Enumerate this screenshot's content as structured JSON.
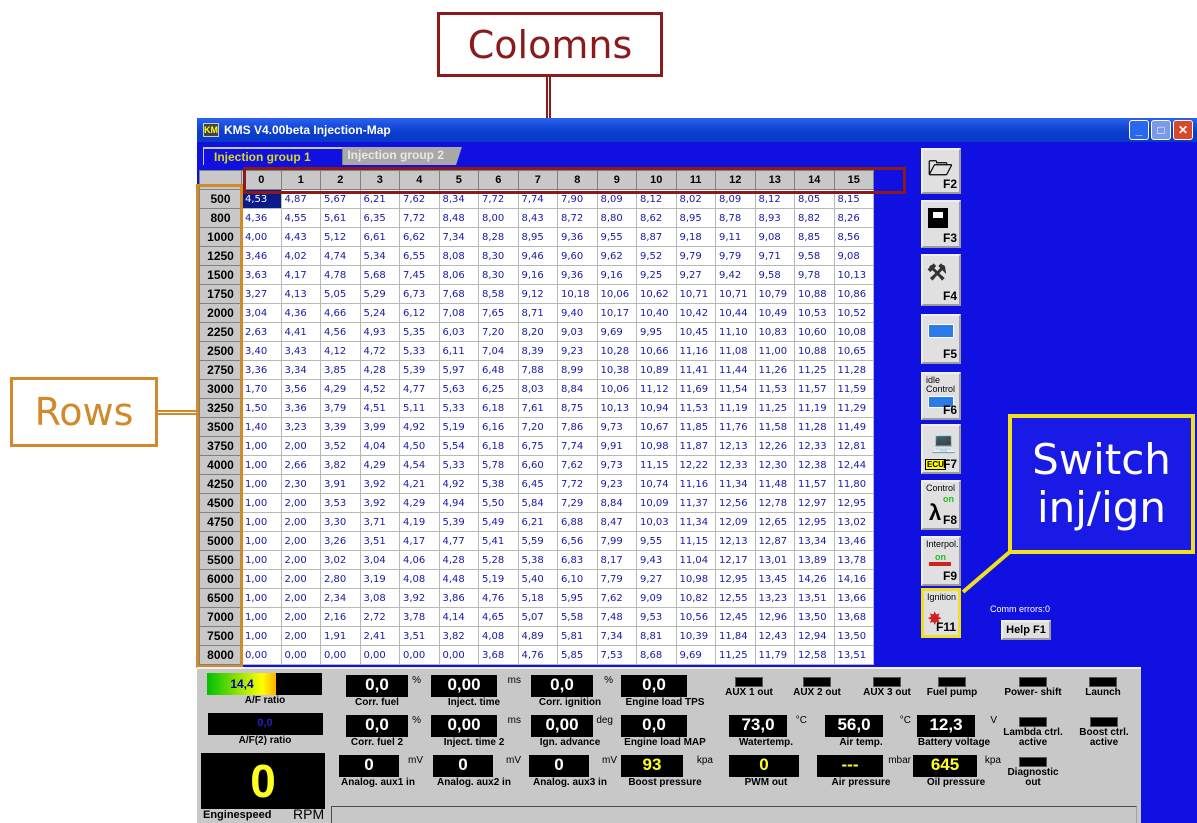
{
  "annotations": {
    "columns_label": "Colomns",
    "rows_label": "Rows",
    "switch_line1": "Switch",
    "switch_line2": "inj/ign"
  },
  "window": {
    "title": "KMS V4.00beta Injection-Map",
    "icon_text": "KM"
  },
  "tabs": [
    {
      "label": "Injection group 1",
      "active": true
    },
    {
      "label": "Injection group 2",
      "active": false
    }
  ],
  "grid": {
    "columns": [
      "0",
      "1",
      "2",
      "3",
      "4",
      "5",
      "6",
      "7",
      "8",
      "9",
      "10",
      "11",
      "12",
      "13",
      "14",
      "15"
    ],
    "rows": [
      {
        "rpm": "500",
        "values": [
          "4,53",
          "4,87",
          "5,67",
          "6,21",
          "7,62",
          "8,34",
          "7,72",
          "7,74",
          "7,90",
          "8,09",
          "8,12",
          "8,02",
          "8,09",
          "8,12",
          "8,05",
          "8,15"
        ]
      },
      {
        "rpm": "800",
        "values": [
          "4,36",
          "4,55",
          "5,61",
          "6,35",
          "7,72",
          "8,48",
          "8,00",
          "8,43",
          "8,72",
          "8,80",
          "8,62",
          "8,95",
          "8,78",
          "8,93",
          "8,82",
          "8,26"
        ]
      },
      {
        "rpm": "1000",
        "values": [
          "4,00",
          "4,43",
          "5,12",
          "6,61",
          "6,62",
          "7,34",
          "8,28",
          "8,95",
          "9,36",
          "9,55",
          "8,87",
          "9,18",
          "9,11",
          "9,08",
          "8,85",
          "8,56"
        ]
      },
      {
        "rpm": "1250",
        "values": [
          "3,46",
          "4,02",
          "4,74",
          "5,34",
          "6,55",
          "8,08",
          "8,30",
          "9,46",
          "9,60",
          "9,62",
          "9,52",
          "9,79",
          "9,79",
          "9,71",
          "9,58",
          "9,08"
        ]
      },
      {
        "rpm": "1500",
        "values": [
          "3,63",
          "4,17",
          "4,78",
          "5,68",
          "7,45",
          "8,06",
          "8,30",
          "9,16",
          "9,36",
          "9,16",
          "9,25",
          "9,27",
          "9,42",
          "9,58",
          "9,78",
          "10,13"
        ]
      },
      {
        "rpm": "1750",
        "values": [
          "3,27",
          "4,13",
          "5,05",
          "5,29",
          "6,73",
          "7,68",
          "8,58",
          "9,12",
          "10,18",
          "10,06",
          "10,62",
          "10,71",
          "10,71",
          "10,79",
          "10,88",
          "10,86"
        ]
      },
      {
        "rpm": "2000",
        "values": [
          "3,04",
          "4,36",
          "4,66",
          "5,24",
          "6,12",
          "7,08",
          "7,65",
          "8,71",
          "9,40",
          "10,17",
          "10,40",
          "10,42",
          "10,44",
          "10,49",
          "10,53",
          "10,52"
        ]
      },
      {
        "rpm": "2250",
        "values": [
          "2,63",
          "4,41",
          "4,56",
          "4,93",
          "5,35",
          "6,03",
          "7,20",
          "8,20",
          "9,03",
          "9,69",
          "9,95",
          "10,45",
          "11,10",
          "10,83",
          "10,60",
          "10,08"
        ]
      },
      {
        "rpm": "2500",
        "values": [
          "3,40",
          "3,43",
          "4,12",
          "4,72",
          "5,33",
          "6,11",
          "7,04",
          "8,39",
          "9,23",
          "10,28",
          "10,66",
          "11,16",
          "11,08",
          "11,00",
          "10,88",
          "10,65"
        ]
      },
      {
        "rpm": "2750",
        "values": [
          "3,36",
          "3,34",
          "3,85",
          "4,28",
          "5,39",
          "5,97",
          "6,48",
          "7,88",
          "8,99",
          "10,38",
          "10,89",
          "11,41",
          "11,44",
          "11,26",
          "11,25",
          "11,28"
        ]
      },
      {
        "rpm": "3000",
        "values": [
          "1,70",
          "3,56",
          "4,29",
          "4,52",
          "4,77",
          "5,63",
          "6,25",
          "8,03",
          "8,84",
          "10,06",
          "11,12",
          "11,69",
          "11,54",
          "11,53",
          "11,57",
          "11,59"
        ]
      },
      {
        "rpm": "3250",
        "values": [
          "1,50",
          "3,36",
          "3,79",
          "4,51",
          "5,11",
          "5,33",
          "6,18",
          "7,61",
          "8,75",
          "10,13",
          "10,94",
          "11,53",
          "11,19",
          "11,25",
          "11,19",
          "11,29"
        ]
      },
      {
        "rpm": "3500",
        "values": [
          "1,40",
          "3,23",
          "3,39",
          "3,99",
          "4,92",
          "5,19",
          "6,16",
          "7,20",
          "7,86",
          "9,73",
          "10,67",
          "11,85",
          "11,76",
          "11,58",
          "11,28",
          "11,49"
        ]
      },
      {
        "rpm": "3750",
        "values": [
          "1,00",
          "2,00",
          "3,52",
          "4,04",
          "4,50",
          "5,54",
          "6,18",
          "6,75",
          "7,74",
          "9,91",
          "10,98",
          "11,87",
          "12,13",
          "12,26",
          "12,33",
          "12,81"
        ]
      },
      {
        "rpm": "4000",
        "values": [
          "1,00",
          "2,66",
          "3,82",
          "4,29",
          "4,54",
          "5,33",
          "5,78",
          "6,60",
          "7,62",
          "9,73",
          "11,15",
          "12,22",
          "12,33",
          "12,30",
          "12,38",
          "12,44"
        ]
      },
      {
        "rpm": "4250",
        "values": [
          "1,00",
          "2,30",
          "3,91",
          "3,92",
          "4,21",
          "4,92",
          "5,38",
          "6,45",
          "7,72",
          "9,23",
          "10,74",
          "11,16",
          "11,34",
          "11,48",
          "11,57",
          "11,80"
        ]
      },
      {
        "rpm": "4500",
        "values": [
          "1,00",
          "2,00",
          "3,53",
          "3,92",
          "4,29",
          "4,94",
          "5,50",
          "5,84",
          "7,29",
          "8,84",
          "10,09",
          "11,37",
          "12,56",
          "12,78",
          "12,97",
          "12,95"
        ]
      },
      {
        "rpm": "4750",
        "values": [
          "1,00",
          "2,00",
          "3,30",
          "3,71",
          "4,19",
          "5,39",
          "5,49",
          "6,21",
          "6,88",
          "8,47",
          "10,03",
          "11,34",
          "12,09",
          "12,65",
          "12,95",
          "13,02"
        ]
      },
      {
        "rpm": "5000",
        "values": [
          "1,00",
          "2,00",
          "3,26",
          "3,51",
          "4,17",
          "4,77",
          "5,41",
          "5,59",
          "6,56",
          "7,99",
          "9,55",
          "11,15",
          "12,13",
          "12,87",
          "13,34",
          "13,46"
        ]
      },
      {
        "rpm": "5500",
        "values": [
          "1,00",
          "2,00",
          "3,02",
          "3,04",
          "4,06",
          "4,28",
          "5,28",
          "5,38",
          "6,83",
          "8,17",
          "9,43",
          "11,04",
          "12,17",
          "13,01",
          "13,89",
          "13,78"
        ]
      },
      {
        "rpm": "6000",
        "values": [
          "1,00",
          "2,00",
          "2,80",
          "3,19",
          "4,08",
          "4,48",
          "5,19",
          "5,40",
          "6,10",
          "7,79",
          "9,27",
          "10,98",
          "12,95",
          "13,45",
          "14,26",
          "14,16"
        ]
      },
      {
        "rpm": "6500",
        "values": [
          "1,00",
          "2,00",
          "2,34",
          "3,08",
          "3,92",
          "3,86",
          "4,76",
          "5,18",
          "5,95",
          "7,62",
          "9,09",
          "10,82",
          "12,55",
          "13,23",
          "13,51",
          "13,66"
        ]
      },
      {
        "rpm": "7000",
        "values": [
          "1,00",
          "2,00",
          "2,16",
          "2,72",
          "3,78",
          "4,14",
          "4,65",
          "5,07",
          "5,58",
          "7,48",
          "9,53",
          "10,56",
          "12,45",
          "12,96",
          "13,50",
          "13,68"
        ]
      },
      {
        "rpm": "7500",
        "values": [
          "1,00",
          "2,00",
          "1,91",
          "2,41",
          "3,51",
          "3,82",
          "4,08",
          "4,89",
          "5,81",
          "7,34",
          "8,81",
          "10,39",
          "11,84",
          "12,43",
          "12,94",
          "13,50"
        ]
      },
      {
        "rpm": "8000",
        "values": [
          "0,00",
          "0,00",
          "0,00",
          "0,00",
          "0,00",
          "0,00",
          "3,68",
          "4,76",
          "5,85",
          "7,53",
          "8,68",
          "9,69",
          "11,25",
          "11,79",
          "12,58",
          "13,51"
        ]
      }
    ]
  },
  "side_buttons": {
    "open_key": "F2",
    "save_key": "F3",
    "tools_key": "F4",
    "table_key": "F5",
    "idle_label": "idle Control",
    "idle_key": "F6",
    "ecu_label": "ECU",
    "ecu_key": "F7",
    "lambda_label": "Control",
    "lambda_on": "on",
    "lambda_key": "F8",
    "interpol_label": "Interpol.",
    "interpol_on": "on",
    "interpol_key": "F9",
    "ignition_label": "Ignition",
    "ignition_key": "F11",
    "comm_errors": "Comm errors:0",
    "help": "Help F1"
  },
  "gauges": {
    "af_ratio": {
      "value": "14,4",
      "label": "A/F ratio",
      "fill_fraction": 0.6
    },
    "af2_ratio": {
      "value": "0,0",
      "label": "A/F(2) ratio"
    },
    "corr_fuel": {
      "value": "0,0",
      "unit": "%",
      "label": "Corr. fuel"
    },
    "corr_fuel2": {
      "value": "0,0",
      "unit": "%",
      "label": "Corr. fuel 2"
    },
    "inject_time": {
      "value": "0,00",
      "unit": "ms",
      "label": "Inject. time"
    },
    "inject_time2": {
      "value": "0,00",
      "unit": "ms",
      "label": "Inject. time 2"
    },
    "corr_ignition": {
      "value": "0,0",
      "unit": "%",
      "label": "Corr. ignition"
    },
    "ign_advance": {
      "value": "0,00",
      "unit": "deg",
      "label": "Ign.  advance"
    },
    "engine_load_tps": {
      "value": "0,0",
      "label": "Engine load TPS"
    },
    "engine_load_map": {
      "value": "0,0",
      "label": "Engine load MAP"
    },
    "watertemp": {
      "value": "73,0",
      "unit": "°C",
      "label": "Watertemp."
    },
    "airtemp": {
      "value": "56,0",
      "unit": "°C",
      "label": "Air temp."
    },
    "battery": {
      "value": "12,3",
      "unit": "V",
      "label": "Battery voltage"
    },
    "aux1": {
      "value": "0",
      "unit": "mV",
      "label": "Analog. aux1 in"
    },
    "aux2": {
      "value": "0",
      "unit": "mV",
      "label": "Analog. aux2 in"
    },
    "aux3": {
      "value": "0",
      "unit": "mV",
      "label": "Analog. aux3 in"
    },
    "boost": {
      "value": "93",
      "unit": "kpa",
      "label": "Boost pressure"
    },
    "pwm": {
      "value": "0",
      "label": "PWM out"
    },
    "airpressure": {
      "value": "---",
      "unit": "mbar",
      "label": "Air pressure"
    },
    "oilpressure": {
      "value": "645",
      "unit": "kpa",
      "label": "Oil pressure"
    },
    "rpm": {
      "value": "0",
      "label": "Enginespeed",
      "unit": "RPM"
    }
  },
  "leds": {
    "aux1_out": "AUX 1 out",
    "aux2_out": "AUX 2 out",
    "aux3_out": "AUX 3 out",
    "fuel_pump": "Fuel pump",
    "power_shift": "Power- shift",
    "launch": "Launch",
    "lambda_ctrl": "Lambda ctrl. active",
    "boost_ctrl": "Boost ctrl. active",
    "diagnostic": "Diagnostic out"
  },
  "colors": {
    "window_bg": "#1010e0",
    "cell_text": "#1818a8",
    "columns_annotation": "#8b1a1a",
    "rows_annotation": "#d08a2c",
    "switch_annotation": "#f0e020"
  }
}
